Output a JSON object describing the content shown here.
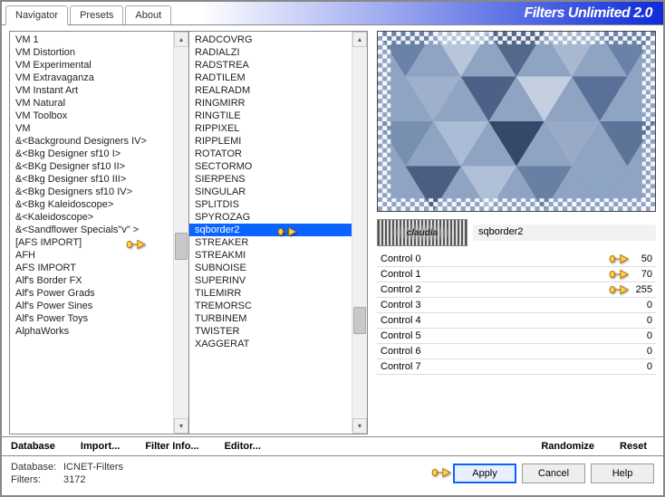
{
  "header": {
    "tabs": [
      "Navigator",
      "Presets",
      "About"
    ],
    "title": "Filters Unlimited 2.0"
  },
  "categories": [
    "VM 1",
    "VM Distortion",
    "VM Experimental",
    "VM Extravaganza",
    "VM Instant Art",
    "VM Natural",
    "VM Toolbox",
    "VM",
    "&<Background Designers IV>",
    "&<Bkg Designer sf10 I>",
    "&<BKg Designer sf10 II>",
    "&<Bkg Designer sf10 III>",
    "&<Bkg Designers sf10 IV>",
    "&<Bkg Kaleidoscope>",
    "&<Kaleidoscope>",
    "&<Sandflower Specials\"v\" >",
    "[AFS IMPORT]",
    "AFH",
    "AFS IMPORT",
    "Alf's Border FX",
    "Alf's Power Grads",
    "Alf's Power Sines",
    "Alf's Power Toys",
    "AlphaWorks"
  ],
  "category_selected_index": 16,
  "filters": [
    "RADCOVRG",
    "RADIALZI",
    "RADSTREA",
    "RADTILEM",
    "REALRADM",
    "RINGMIRR",
    "RINGTILE",
    "RIPPIXEL",
    "RIPPLEMI",
    "ROTATOR",
    "SECTORMO",
    "SIERPENS",
    "SINGULAR",
    "SPLITDIS",
    "SPYROZAG",
    "sqborder2",
    "STREAKER",
    "STREAKMI",
    "SUBNOISE",
    "SUPERINV",
    "TILEMIRR",
    "TREMORSC",
    "TURBINEM",
    "TWISTER",
    "XAGGERAT"
  ],
  "filter_selected_index": 15,
  "filter_name": "sqborder2",
  "watermark": "claudia",
  "controls": [
    {
      "label": "Control 0",
      "value": 50,
      "pointer": true
    },
    {
      "label": "Control 1",
      "value": 70,
      "pointer": true
    },
    {
      "label": "Control 2",
      "value": 255,
      "pointer": true
    },
    {
      "label": "Control 3",
      "value": 0
    },
    {
      "label": "Control 4",
      "value": 0
    },
    {
      "label": "Control 5",
      "value": 0
    },
    {
      "label": "Control 6",
      "value": 0
    },
    {
      "label": "Control 7",
      "value": 0
    }
  ],
  "toolbar": {
    "database": "Database",
    "import": "Import...",
    "filter_info": "Filter Info...",
    "editor": "Editor...",
    "randomize": "Randomize",
    "reset": "Reset"
  },
  "footer": {
    "database_label": "Database:",
    "database_value": "ICNET-Filters",
    "filters_label": "Filters:",
    "filters_value": "3172",
    "apply": "Apply",
    "cancel": "Cancel",
    "help": "Help"
  }
}
